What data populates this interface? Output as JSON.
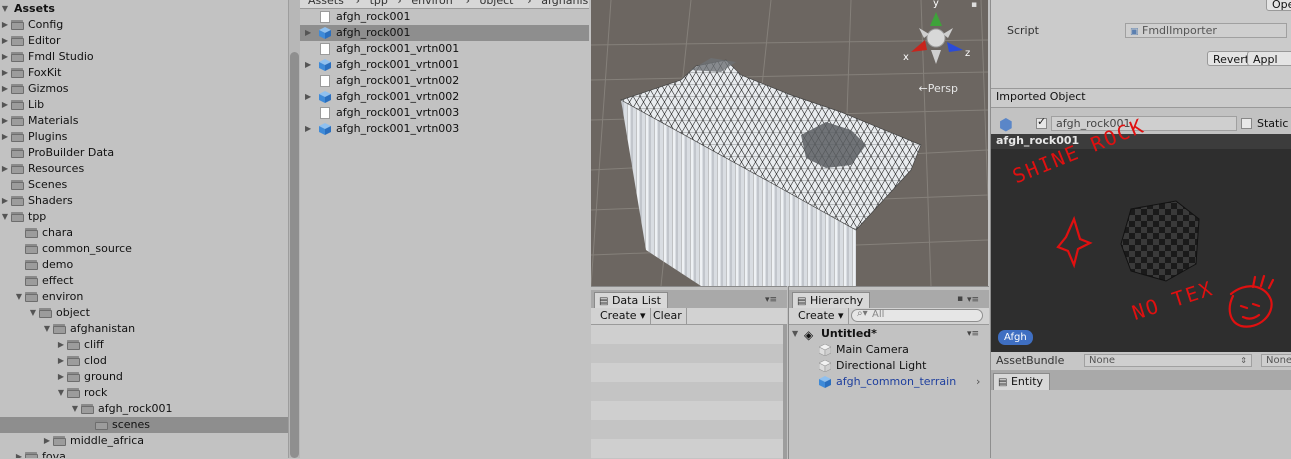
{
  "project": {
    "root": "Assets",
    "folders": [
      {
        "label": "Config",
        "depth": 0,
        "expanded": false
      },
      {
        "label": "Editor",
        "depth": 0,
        "expanded": false
      },
      {
        "label": "Fmdl Studio",
        "depth": 0,
        "expanded": false
      },
      {
        "label": "FoxKit",
        "depth": 0,
        "expanded": false
      },
      {
        "label": "Gizmos",
        "depth": 0,
        "expanded": false
      },
      {
        "label": "Lib",
        "depth": 0,
        "expanded": false
      },
      {
        "label": "Materials",
        "depth": 0,
        "expanded": false
      },
      {
        "label": "Plugins",
        "depth": 0,
        "expanded": false
      },
      {
        "label": "ProBuilder Data",
        "depth": 0,
        "expanded": null
      },
      {
        "label": "Resources",
        "depth": 0,
        "expanded": false
      },
      {
        "label": "Scenes",
        "depth": 0,
        "expanded": null
      },
      {
        "label": "Shaders",
        "depth": 0,
        "expanded": false
      },
      {
        "label": "tpp",
        "depth": 0,
        "expanded": true
      },
      {
        "label": "chara",
        "depth": 1,
        "expanded": null
      },
      {
        "label": "common_source",
        "depth": 1,
        "expanded": null
      },
      {
        "label": "demo",
        "depth": 1,
        "expanded": null
      },
      {
        "label": "effect",
        "depth": 1,
        "expanded": null
      },
      {
        "label": "environ",
        "depth": 1,
        "expanded": true
      },
      {
        "label": "object",
        "depth": 2,
        "expanded": true
      },
      {
        "label": "afghanistan",
        "depth": 3,
        "expanded": true
      },
      {
        "label": "cliff",
        "depth": 4,
        "expanded": false
      },
      {
        "label": "clod",
        "depth": 4,
        "expanded": false
      },
      {
        "label": "ground",
        "depth": 4,
        "expanded": false
      },
      {
        "label": "rock",
        "depth": 4,
        "expanded": true
      },
      {
        "label": "afgh_rock001",
        "depth": 5,
        "expanded": true
      },
      {
        "label": "scenes",
        "depth": 6,
        "expanded": null,
        "selected": true
      },
      {
        "label": "middle_africa",
        "depth": 3,
        "expanded": false
      },
      {
        "label": "fova",
        "depth": 1,
        "expanded": false
      }
    ]
  },
  "breadcrumb": [
    "Assets",
    "tpp",
    "environ",
    "object",
    "afghanistan"
  ],
  "files": [
    {
      "label": "afgh_rock001",
      "icon": "document-icon",
      "expandable": false,
      "selected": false
    },
    {
      "label": "afgh_rock001",
      "icon": "model-icon",
      "expandable": true,
      "selected": true
    },
    {
      "label": "afgh_rock001_vrtn001",
      "icon": "document-icon",
      "expandable": false,
      "selected": false
    },
    {
      "label": "afgh_rock001_vrtn001",
      "icon": "model-icon",
      "expandable": true,
      "selected": false
    },
    {
      "label": "afgh_rock001_vrtn002",
      "icon": "document-icon",
      "expandable": false,
      "selected": false
    },
    {
      "label": "afgh_rock001_vrtn002",
      "icon": "model-icon",
      "expandable": true,
      "selected": false
    },
    {
      "label": "afgh_rock001_vrtn003",
      "icon": "document-icon",
      "expandable": false,
      "selected": false
    },
    {
      "label": "afgh_rock001_vrtn003",
      "icon": "model-icon",
      "expandable": true,
      "selected": false
    }
  ],
  "scene": {
    "gizmo_axes": {
      "x": "x",
      "y": "y",
      "z": "z"
    },
    "projection_label": "←Persp",
    "axis_colors": {
      "x": "#c8241c",
      "y": "#3ea33a",
      "z": "#2a4bd8"
    }
  },
  "datalist": {
    "tab": "Data List",
    "create": "Create",
    "clear": "Clear"
  },
  "hierarchy": {
    "tab": "Hierarchy",
    "create": "Create",
    "search_placeholder": "All",
    "scene_name": "Untitled*",
    "items": [
      "Main Camera",
      "Directional Light",
      "afgh_common_terrain"
    ]
  },
  "inspector": {
    "open_label": "Ope",
    "script_label": "Script",
    "script_value": "FmdlImporter",
    "revert": "Revert",
    "apply": "Appl",
    "imported_object": "Imported Object",
    "object_name": "afgh_rock001",
    "static_label": "Static",
    "preview_title": "afgh_rock001",
    "preview_annotations": [
      "SHINE ROCK",
      "NO TEX"
    ],
    "label_badge": "Afgh",
    "assetbundle_label": "AssetBundle",
    "assetbundle_value": "None",
    "assetbundle_variant": "None",
    "entity_tab": "Entity"
  }
}
